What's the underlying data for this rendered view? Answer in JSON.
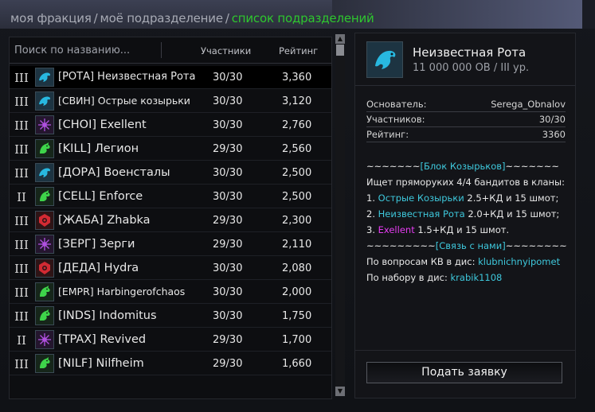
{
  "breadcrumb": {
    "item1": "моя фракция",
    "sep": "/",
    "item2": "моё подразделение",
    "item3": "список подразделений"
  },
  "list": {
    "search_placeholder": "Поиск по названию...",
    "col_members": "Участники",
    "col_rating": "Рейтинг",
    "rows": [
      {
        "rank": "III",
        "name": "[РОТА] Неизвестная Рота",
        "members": "30/30",
        "rating": "3,360",
        "emblem": "eagle-icon",
        "selected": true
      },
      {
        "rank": "III",
        "name": "[СВИН] Острые козырьки",
        "members": "30/30",
        "rating": "3,120",
        "emblem": "eagle-icon"
      },
      {
        "rank": "III",
        "name": "[CHOI] Exellent",
        "members": "30/30",
        "rating": "2,760",
        "emblem": "flower-icon"
      },
      {
        "rank": "III",
        "name": "[KILL] Легион",
        "members": "29/30",
        "rating": "2,560",
        "emblem": "dragon-icon"
      },
      {
        "rank": "III",
        "name": "[ДОРА] Военсталы",
        "members": "30/30",
        "rating": "2,500",
        "emblem": "eagle-icon"
      },
      {
        "rank": "II",
        "name": "[CELL] Enforce",
        "members": "30/30",
        "rating": "2,500",
        "emblem": "dragon-icon"
      },
      {
        "rank": "III",
        "name": "[ЖАБА] Zhabka",
        "members": "29/30",
        "rating": "2,300",
        "emblem": "red-crest-icon"
      },
      {
        "rank": "III",
        "name": "[ЗЕРГ] Зерги",
        "members": "29/30",
        "rating": "2,110",
        "emblem": "flower-icon"
      },
      {
        "rank": "III",
        "name": "[ДЕДА] Hydra",
        "members": "30/30",
        "rating": "2,080",
        "emblem": "red-crest-icon"
      },
      {
        "rank": "III",
        "name": "[EMPR] Harbingerofchaos",
        "members": "30/30",
        "rating": "2,000",
        "emblem": "dragon-icon"
      },
      {
        "rank": "III",
        "name": "[INDS] Indomitus",
        "members": "30/30",
        "rating": "1,750",
        "emblem": "dragon-icon"
      },
      {
        "rank": "II",
        "name": "[TPAX] Revived",
        "members": "29/30",
        "rating": "1,700",
        "emblem": "flower-icon"
      },
      {
        "rank": "III",
        "name": "[NILF] Nilfheim",
        "members": "29/30",
        "rating": "1,660",
        "emblem": "dragon-icon"
      }
    ]
  },
  "detail": {
    "name": "Неизвестная Рота",
    "subtitle": "11 000 000 ОВ / III ур.",
    "founder_label": "Основатель:",
    "founder": "Serega_Obnalov",
    "members_label": "Участников:",
    "members": "30/30",
    "rating_label": "Рейтинг:",
    "rating": "3360",
    "desc": {
      "l1_pre": "~~~~~~~",
      "l1_mid": "[Блок Козырьков]",
      "l1_post": "~~~~~~~",
      "l2": "Ищет пряморуких 4/4 бандитов в кланы:",
      "l3_pre": "1. ",
      "l3_mid": "Острые Козырьки",
      "l3_post": " 2.5+КД и 15 шмот;",
      "l4_pre": "2. ",
      "l4_mid": "Неизвестная Рота",
      "l4_post": " 2.0+КД и 15 шмот;",
      "l5_pre": "3. ",
      "l5_mid": "Exellent",
      "l5_post": " 1.5+КД и 15 шмот.",
      "l6_pre": "~~~~~~~~~",
      "l6_mid": "[Связь с нами]",
      "l6_post": "~~~~~~~~",
      "l7_pre": "По вопросам КВ в дис: ",
      "l7_mid": "klubnichnyipomet",
      "l8_pre": "По набору в дис: ",
      "l8_mid": "krabik1108"
    },
    "apply_label": "Подать заявку"
  },
  "colors": {
    "accent_green": "#2ec72e",
    "cyan": "#3ec8dc",
    "pink": "#e43cf0"
  }
}
